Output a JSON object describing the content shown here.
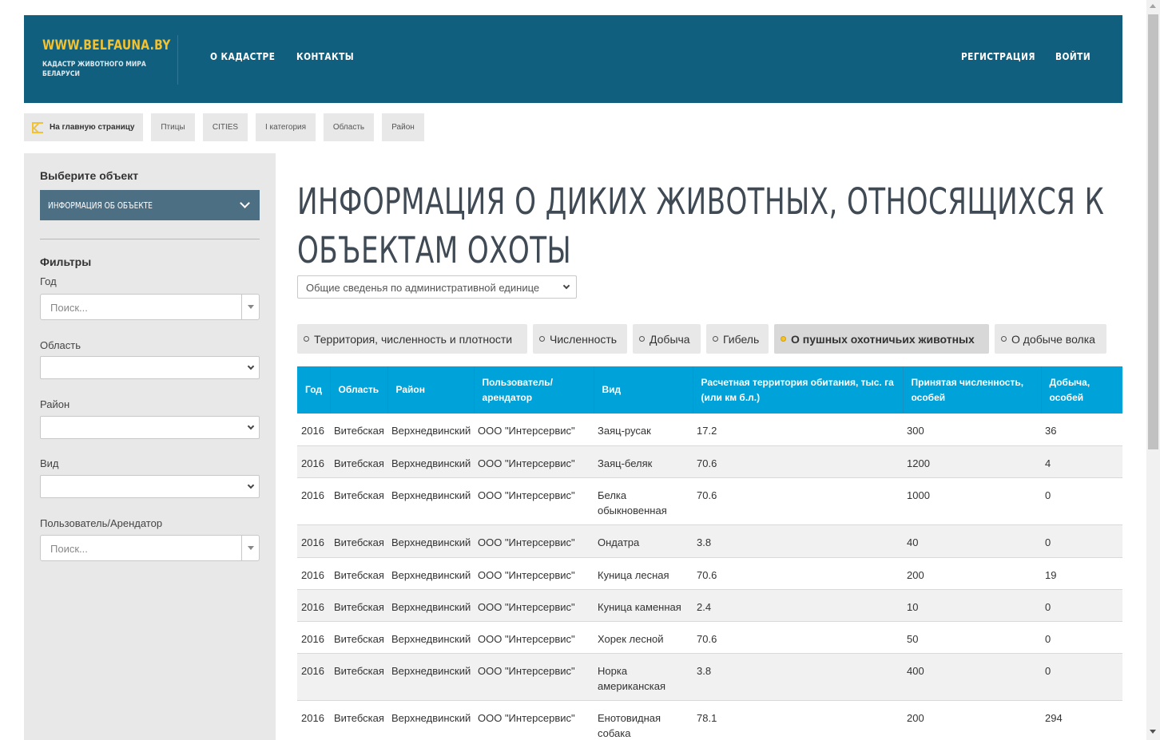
{
  "header": {
    "site_name": "WWW.BELFAUNA.BY",
    "site_subtitle": "КАДАСТР ЖИВОТНОГО МИРА БЕЛАРУСИ",
    "nav_about": "О КАДАСТРЕ",
    "nav_contacts": "КОНТАКТЫ",
    "nav_register": "РЕГИСТРАЦИЯ",
    "nav_login": "ВОЙТИ"
  },
  "breadcrumb": {
    "home": "На главную страницу",
    "items": [
      "Птицы",
      "CITIES",
      "I категория",
      "Область",
      "Район"
    ]
  },
  "sidebar": {
    "select_title": "Выберите объект",
    "object_select_value": "ИНФОРМАЦИЯ ОБ ОБЪЕКТЕ",
    "filters_title": "Фильтры",
    "year_label": "Год",
    "year_placeholder": "Поиск...",
    "region_label": "Область",
    "district_label": "Район",
    "species_label": "Вид",
    "user_label": "Пользователь/Арендатор",
    "user_placeholder": "Поиск..."
  },
  "main": {
    "title": "Информация о диких животных, относящихся к объектам охоты",
    "admin_select_value": "Общие сведенья по административной единице",
    "tabs": [
      {
        "label": "Территория, численность и плотности",
        "active": false
      },
      {
        "label": "Численность",
        "active": false
      },
      {
        "label": "Добыча",
        "active": false
      },
      {
        "label": "Гибель",
        "active": false
      },
      {
        "label": "О пушных охотничьих животных",
        "active": true
      },
      {
        "label": "О добыче волка",
        "active": false
      }
    ]
  },
  "table": {
    "headers": [
      "Год",
      "Область",
      "Район",
      "Пользователь/ арендатор",
      "Вид",
      "Расчетная территория обитания, тыс. га (или км б.л.)",
      "Принятая численность, особей",
      "Добыча, особей"
    ],
    "rows": [
      [
        "2016",
        "Витебская",
        "Верхнедвинский",
        "ООО \"Интерсервис\"",
        "Заяц-русак",
        "17.2",
        "300",
        "36"
      ],
      [
        "2016",
        "Витебская",
        "Верхнедвинский",
        "ООО \"Интерсервис\"",
        "Заяц-беляк",
        "70.6",
        "1200",
        "4"
      ],
      [
        "2016",
        "Витебская",
        "Верхнедвинский",
        "ООО \"Интерсервис\"",
        "Белка обыкновенная",
        "70.6",
        "1000",
        "0"
      ],
      [
        "2016",
        "Витебская",
        "Верхнедвинский",
        "ООО \"Интерсервис\"",
        "Ондатра",
        "3.8",
        "40",
        "0"
      ],
      [
        "2016",
        "Витебская",
        "Верхнедвинский",
        "ООО \"Интерсервис\"",
        "Куница лесная",
        "70.6",
        "200",
        "19"
      ],
      [
        "2016",
        "Витебская",
        "Верхнедвинский",
        "ООО \"Интерсервис\"",
        "Куница каменная",
        "2.4",
        "10",
        "0"
      ],
      [
        "2016",
        "Витебская",
        "Верхнедвинский",
        "ООО \"Интерсервис\"",
        "Хорек лесной",
        "70.6",
        "50",
        "0"
      ],
      [
        "2016",
        "Витебская",
        "Верхнедвинский",
        "ООО \"Интерсервис\"",
        "Норка американская",
        "3.8",
        "400",
        "0"
      ],
      [
        "2016",
        "Витебская",
        "Верхнедвинский",
        "ООО \"Интерсервис\"",
        "Енотовидная собака",
        "78.1",
        "200",
        "294"
      ]
    ]
  },
  "colors": {
    "header_bg": "#115f7e",
    "logo_accent": "#f1c232",
    "table_header_bg": "#00a3d9",
    "object_select_bg": "#4d6f84",
    "active_tab_dot": "#f1c232"
  },
  "icons": {
    "home": "home-arrow-icon",
    "dropdown": "chevron-down-icon",
    "combo_arrow": "triangle-down-icon",
    "tab_marker": "radio-dot-icon"
  }
}
